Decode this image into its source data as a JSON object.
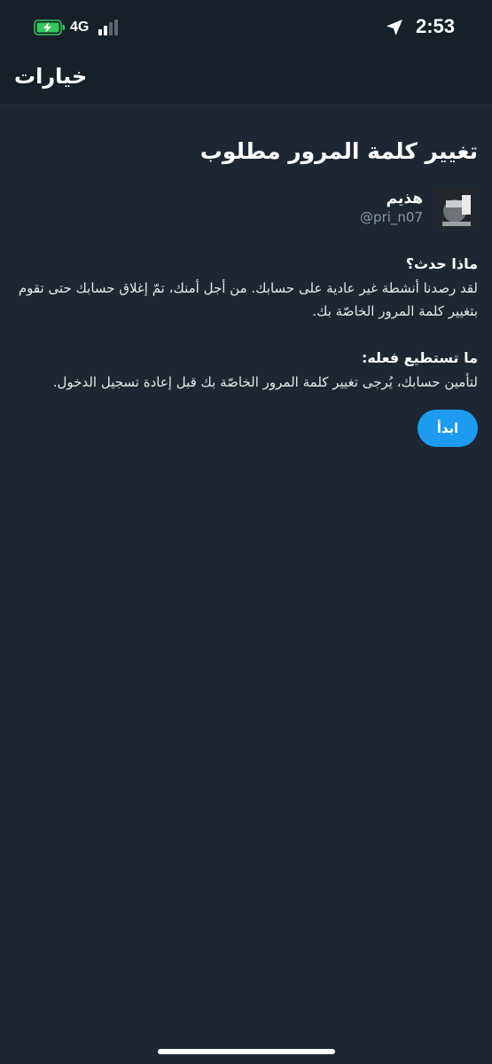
{
  "status_bar": {
    "time": "2:53",
    "network": "4G"
  },
  "nav": {
    "title": "خيارات"
  },
  "page": {
    "heading": "تغيير كلمة المرور مطلوب"
  },
  "account": {
    "name": "هذيم",
    "handle": "@pri_n07"
  },
  "sections": [
    {
      "title": "ماذا حدث؟",
      "text": "لقد رصدنا أنشطة غير عادية على حسابك. من أجل أمنك، تمّ إغلاق حسابك حتى تقوم بتغيير كلمة المرور الخاصّة بك."
    },
    {
      "title": "ما تستطيع فعله:",
      "text": "لتأمين حسابك، يُرجى تغيير كلمة المرور الخاصّة بك قبل إعادة تسجيل الدخول."
    }
  ],
  "actions": {
    "start_label": "ابدأ"
  },
  "colors": {
    "background": "#1c2733",
    "accent": "#1d9bf0",
    "battery": "#34c759"
  },
  "icons": {
    "location": "location-arrow-icon",
    "battery": "battery-charging-icon",
    "signal": "cellular-signal-icon"
  }
}
